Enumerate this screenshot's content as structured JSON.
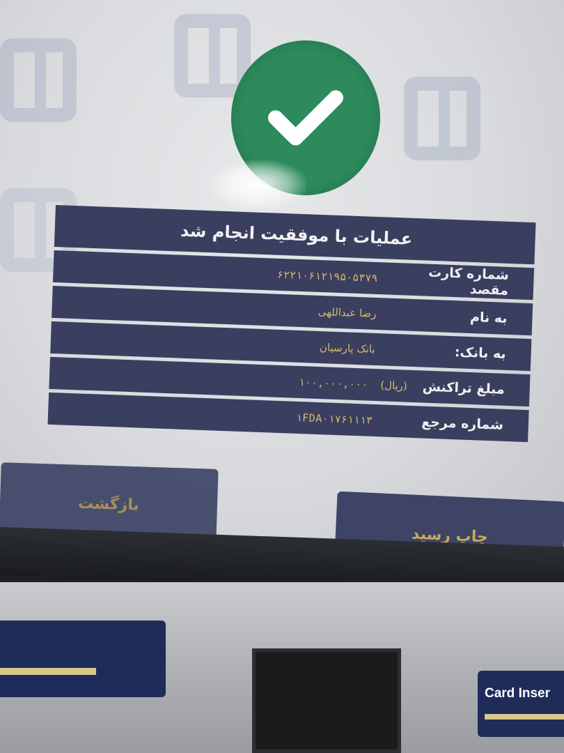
{
  "screen": {
    "title": "عملیات با موفقیت انجام شد",
    "success_icon": "checkmark-icon",
    "rows": [
      {
        "label": "شماره کارت مقصد",
        "value": "۶۲۲۱۰۶۱۲۱۹۵۰۵۳۷۹"
      },
      {
        "label": "به نام",
        "value": "رضا عبداللهی"
      },
      {
        "label": "به بانک:",
        "value": "بانک پارسیان"
      },
      {
        "label": "مبلغ تراکنش",
        "unit": "(ریال)",
        "value": "۱۰۰,۰۰۰,۰۰۰"
      },
      {
        "label": "شماره مرجع",
        "value": "۱FDA۰۱۷۶۱۱۱۳"
      }
    ],
    "buttons": {
      "back": "بازگشت",
      "print_receipt": "چاپ رسید"
    }
  },
  "hardware": {
    "card_insert_label": "Card Inser"
  },
  "colors": {
    "success_green": "#2c8a5b",
    "panel_navy": "#3a3f60",
    "value_gold": "#d9b96a"
  }
}
